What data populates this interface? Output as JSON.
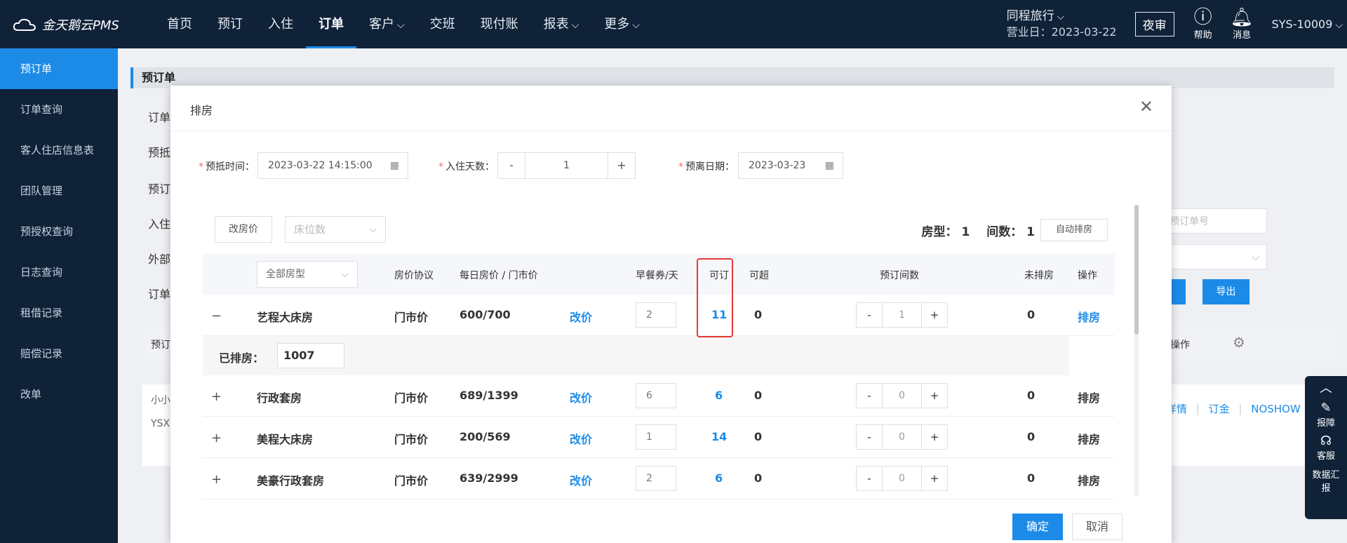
{
  "topbar": {
    "logo": "金天鹅云PMS",
    "nav": [
      {
        "label": "首页",
        "dropdown": false,
        "active": false
      },
      {
        "label": "预订",
        "dropdown": false,
        "active": false
      },
      {
        "label": "入住",
        "dropdown": false,
        "active": false
      },
      {
        "label": "订单",
        "dropdown": false,
        "active": true
      },
      {
        "label": "客户",
        "dropdown": true,
        "active": false
      },
      {
        "label": "交班",
        "dropdown": false,
        "active": false
      },
      {
        "label": "现付账",
        "dropdown": false,
        "active": false
      },
      {
        "label": "报表",
        "dropdown": true,
        "active": false
      },
      {
        "label": "更多",
        "dropdown": true,
        "active": false
      }
    ],
    "hotel_name": "同程旅行",
    "business_day": "营业日：2023-03-22",
    "night_audit": "夜审",
    "help": "帮助",
    "messages": "消息",
    "user": "SYS-10009"
  },
  "sidebar": {
    "items": [
      "预订单",
      "订单查询",
      "客人住店信息表",
      "团队管理",
      "预授权查询",
      "日志查询",
      "租借记录",
      "赔偿记录",
      "改单"
    ],
    "active_index": 0
  },
  "background": {
    "page_title": "预订单",
    "labels": [
      "订单",
      "预抵",
      "预订",
      "入住",
      "外部",
      "订单"
    ],
    "table_header_left": "预订",
    "order_input_placeholder": "预订单号",
    "export_button": "导出",
    "ops_header": "操作",
    "row_text_1": "小小",
    "row_text_2": "YSX",
    "links": [
      "详情",
      "订金",
      "NOSHOW"
    ]
  },
  "floatbar": {
    "report": "报障",
    "service": "客服",
    "data": "数据汇报"
  },
  "modal": {
    "title": "排房",
    "arrival_label": "预抵时间：",
    "arrival_value": "2023-03-22 14:15:00",
    "nights_label": "入住天数：",
    "nights_value": "1",
    "departure_label": "预离日期：",
    "departure_value": "2023-03-23",
    "change_price_button": "改房价",
    "bed_select_placeholder": "床位数",
    "summary_room_type_label": "房型：",
    "summary_room_type_value": "1",
    "summary_rooms_label": "间数：",
    "summary_rooms_value": "1",
    "auto_assign_button": "自动排房",
    "headers": {
      "room_type_select": "全部房型",
      "rate_plan": "房价协议",
      "daily_price": "每日房价 / 门市价",
      "breakfast": "早餐券/天",
      "available": "可订",
      "overbook": "可超",
      "booked_rooms": "预订间数",
      "unassigned": "未排房",
      "actions": "操作"
    },
    "rows": [
      {
        "expander": "−",
        "room": "艺程大床房",
        "rate": "门市价",
        "price": "600/700",
        "change": "改价",
        "breakfast": "2",
        "available": "11",
        "overbook": "0",
        "qty": "1",
        "unassigned": "0",
        "action": "排房",
        "action_link": true
      },
      {
        "expander": "+",
        "room": "行政套房",
        "rate": "门市价",
        "price": "689/1399",
        "change": "改价",
        "breakfast": "6",
        "available": "6",
        "overbook": "0",
        "qty": "0",
        "unassigned": "0",
        "action": "排房",
        "action_link": false
      },
      {
        "expander": "+",
        "room": "美程大床房",
        "rate": "门市价",
        "price": "200/569",
        "change": "改价",
        "breakfast": "1",
        "available": "14",
        "overbook": "0",
        "qty": "0",
        "unassigned": "0",
        "action": "排房",
        "action_link": false
      },
      {
        "expander": "+",
        "room": "美豪行政套房",
        "rate": "门市价",
        "price": "639/2999",
        "change": "改价",
        "breakfast": "2",
        "available": "6",
        "overbook": "0",
        "qty": "0",
        "unassigned": "0",
        "action": "排房",
        "action_link": false
      }
    ],
    "assigned_label": "已排房：",
    "assigned_value": "1007",
    "confirm_button": "确定",
    "cancel_button": "取消"
  },
  "colors": {
    "primary": "#1c8be8",
    "nav_bg": "#0f2238",
    "highlight": "#e53935"
  }
}
